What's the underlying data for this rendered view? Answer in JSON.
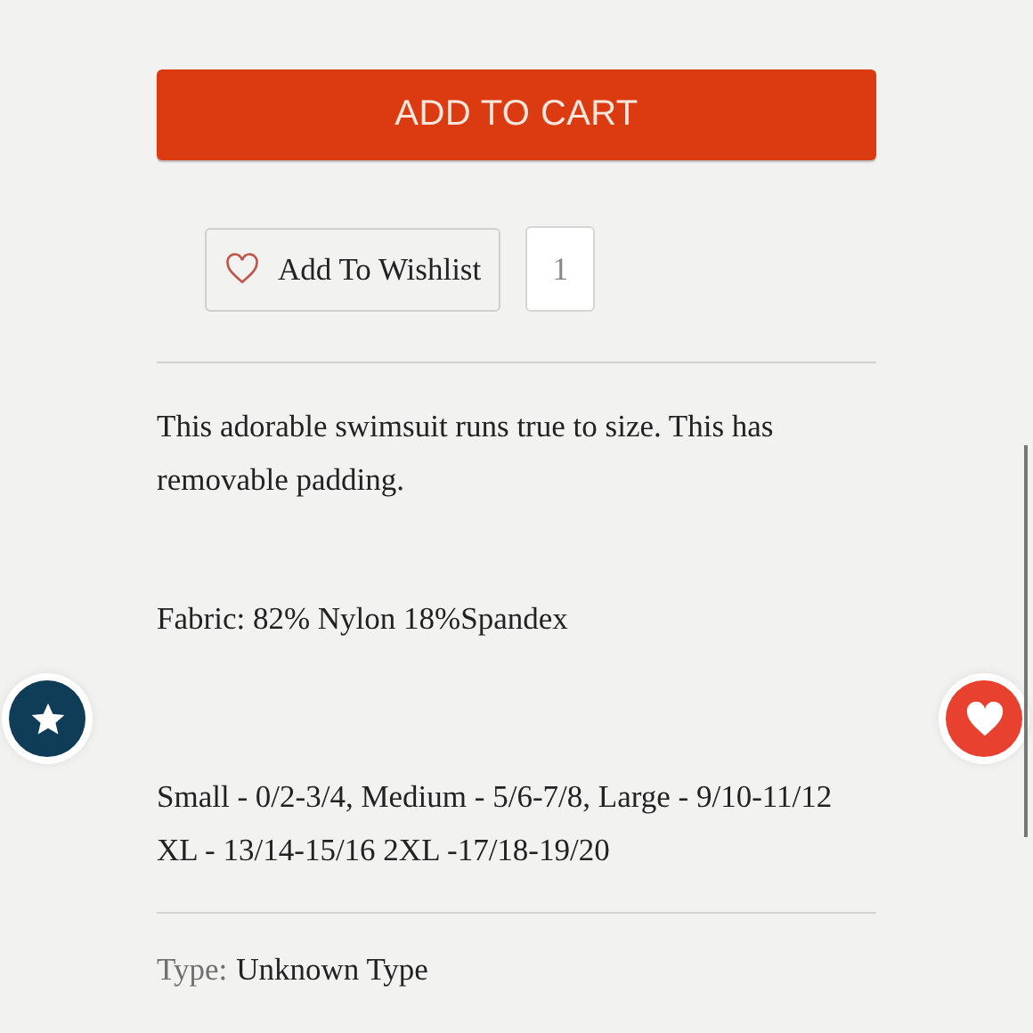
{
  "add_to_cart": {
    "label": "ADD TO CART"
  },
  "wishlist": {
    "label": "Add To Wishlist",
    "count": "1"
  },
  "description": [
    "This adorable swimsuit runs true to size. This has removable padding.",
    "Fabric: 82% Nylon 18%Spandex",
    "Small - 0/2-3/4, Medium - 5/6-7/8, Large - 9/10-11/12 XL - 13/14-15/16 2XL -17/18-19/20"
  ],
  "type": {
    "label": "Type:",
    "value": "Unknown Type"
  }
}
